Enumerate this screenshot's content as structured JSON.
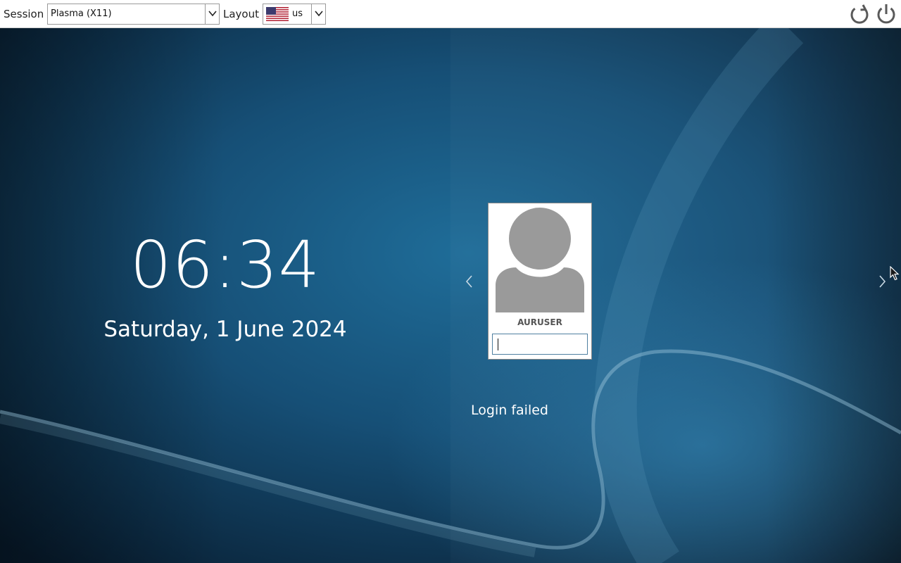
{
  "topbar": {
    "session_label": "Session",
    "session_value": "Plasma (X11)",
    "layout_label": "Layout",
    "layout_value": "us",
    "layout_flag_icon": "us-flag-icon",
    "reboot_icon": "reboot-icon",
    "shutdown_icon": "power-icon"
  },
  "clock": {
    "time": "06:34",
    "date": "Saturday, 1 June 2024"
  },
  "login": {
    "username": "AURUSER",
    "password_value": "",
    "status": "Login failed",
    "prev_icon": "chevron-left-icon",
    "next_icon": "chevron-right-icon"
  },
  "colors": {
    "background": "#0c2a44",
    "accent": "#1e6a94",
    "avatar": "#9a9a9a"
  }
}
